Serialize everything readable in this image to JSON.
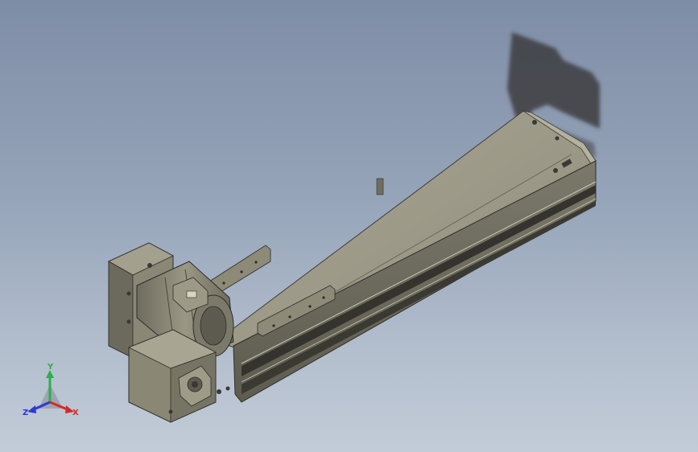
{
  "viewport": {
    "background_top": "#7e8da6",
    "background_bottom": "#c2ccd8"
  },
  "model": {
    "body_color": "#8d8a78",
    "top_color": "#a3a08e",
    "side_color": "#6c6a5c",
    "dark_color": "#2f2f2a",
    "shadow_color": "#3b3b3f"
  },
  "triad": {
    "x_label": "X",
    "y_label": "Y",
    "z_label": "Z",
    "x_color": "#d42a2a",
    "y_color": "#2ab04a",
    "z_color": "#2a3ad4"
  }
}
